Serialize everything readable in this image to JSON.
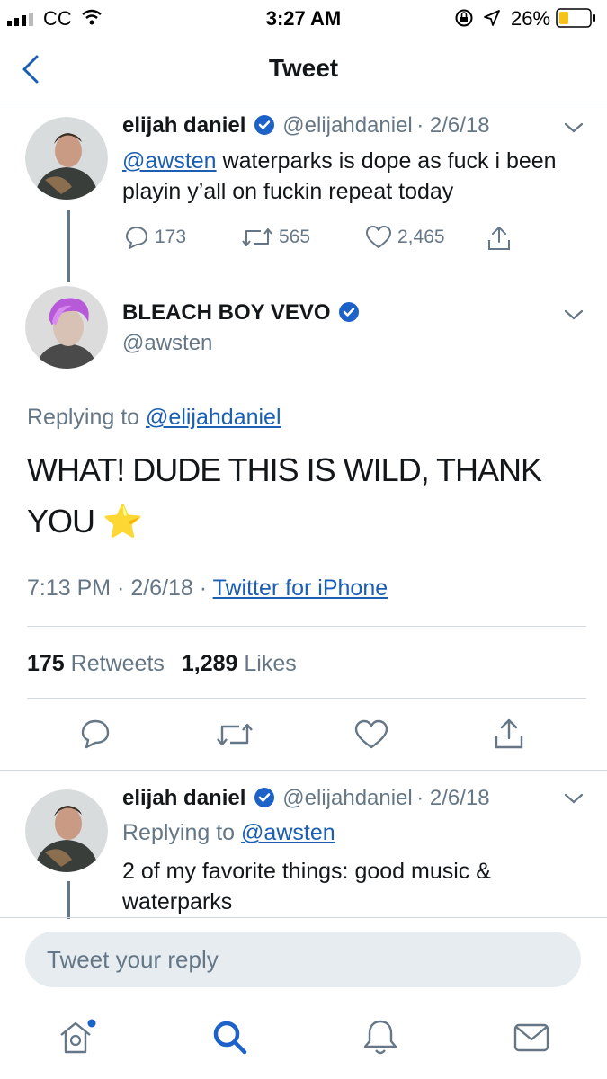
{
  "status_bar": {
    "carrier": "CC",
    "time": "3:27 AM",
    "battery": "26%"
  },
  "nav": {
    "title": "Tweet"
  },
  "parent_tweet": {
    "name": "elijah daniel",
    "handle": "@elijahdaniel",
    "date": "· 2/6/18",
    "mention": "@awsten",
    "text": " waterparks is dope as fuck i been playin y’all on fuckin repeat today",
    "replies": "173",
    "retweets": "565",
    "likes": "2,465"
  },
  "main_tweet": {
    "name": "BLEACH BOY VEVO",
    "handle": "@awsten",
    "replying_prefix": "Replying to ",
    "replying_to": "@elijahdaniel",
    "text": "WHAT! DUDE THIS IS WILD, THANK YOU",
    "emoji": "⭐",
    "timestamp": "7:13 PM · 2/6/18 · ",
    "source": "Twitter for iPhone",
    "retweet_count": "175",
    "retweet_label": "Retweets",
    "like_count": "1,289",
    "like_label": "Likes"
  },
  "reply_tweet": {
    "name": "elijah daniel",
    "handle": "@elijahdaniel",
    "date": "· 2/6/18",
    "replying_prefix": "Replying to ",
    "replying_to": "@awsten",
    "text": "2 of my favorite things: good music & waterparks"
  },
  "composer": {
    "placeholder": "Tweet your reply"
  },
  "colors": {
    "link": "#1b5fb4",
    "verified": "#1d62c9",
    "gray_text": "#657786",
    "divider": "#d4d9dd",
    "reply_box": "#e6ecf0",
    "battery_fill": "#f4c21b"
  },
  "icons": [
    "back-chevron-icon",
    "verified-icon",
    "reply-icon",
    "retweet-icon",
    "like-icon",
    "share-icon",
    "chevron-down-icon",
    "home-icon",
    "search-icon",
    "notifications-icon",
    "messages-icon",
    "wifi-icon",
    "signal-icon",
    "lock-rotation-icon",
    "location-icon",
    "battery-icon"
  ]
}
